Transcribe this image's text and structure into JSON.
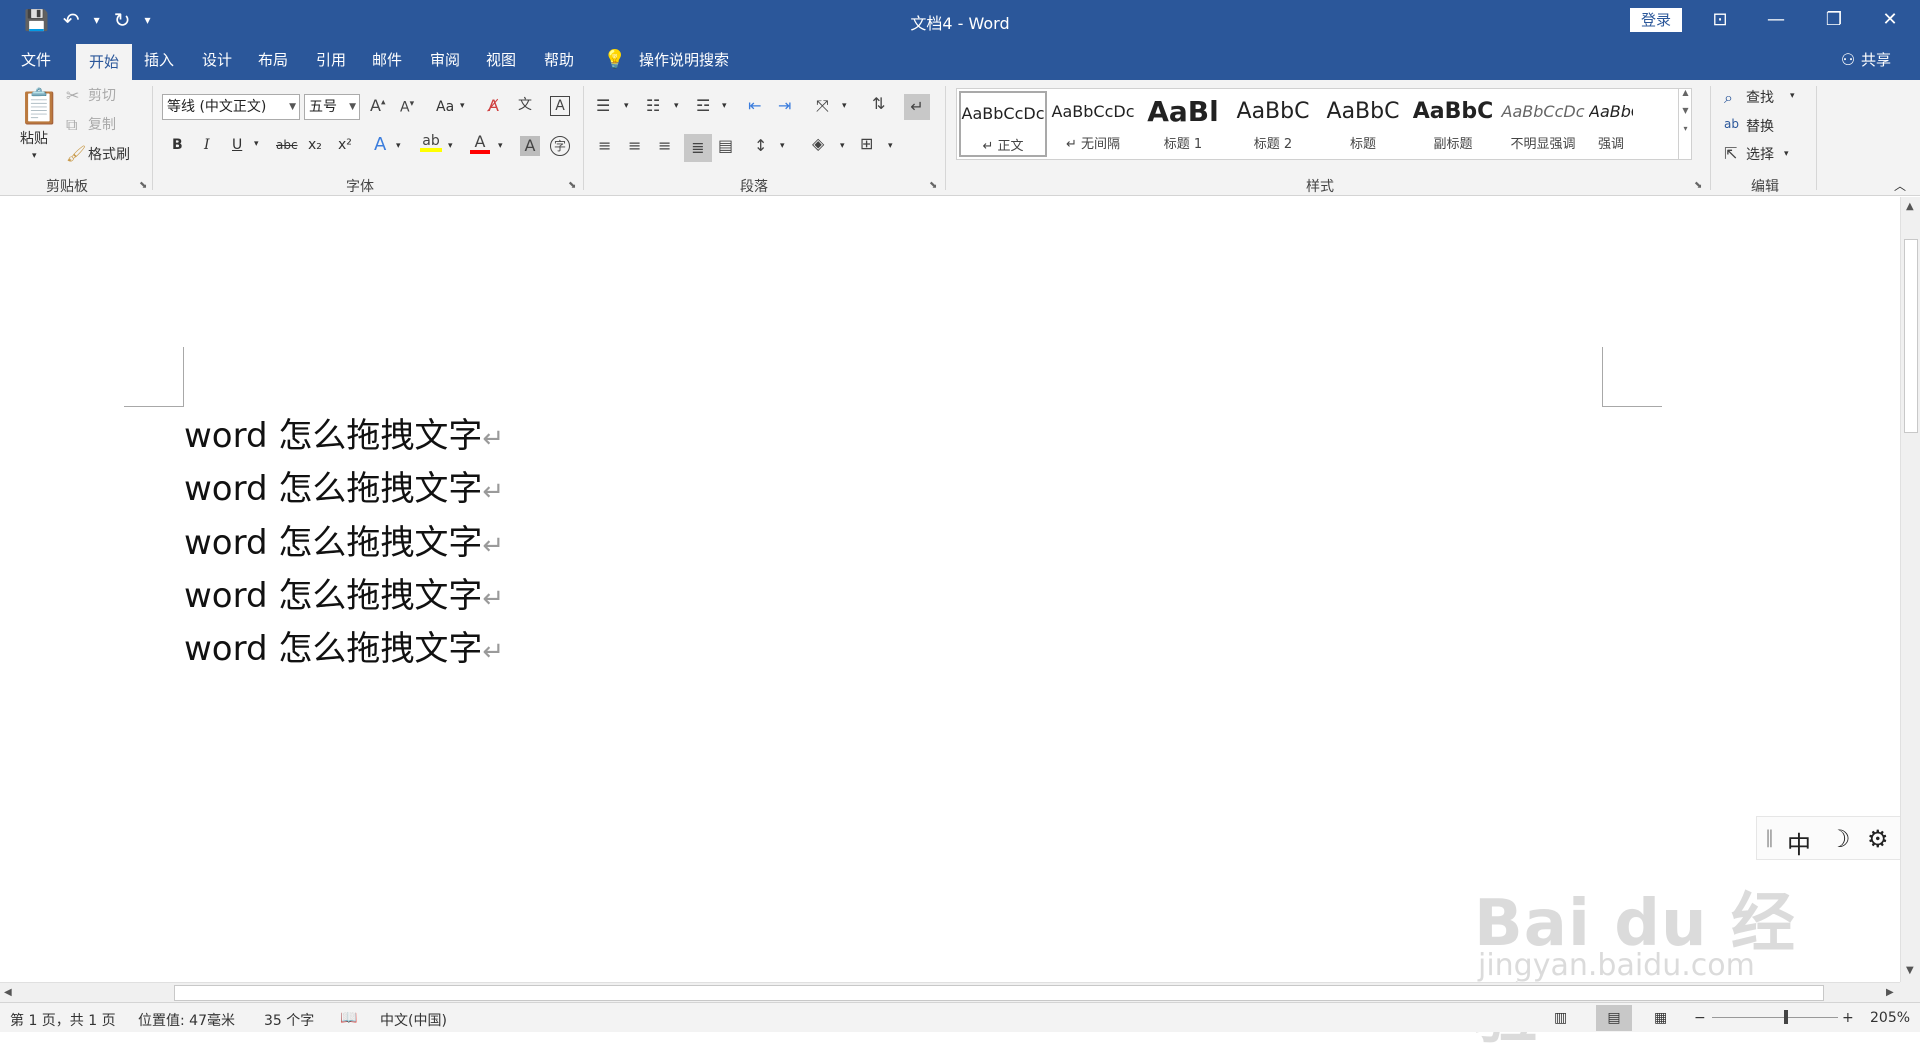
{
  "window": {
    "title": "文档4  -  Word",
    "login_label": "登录"
  },
  "quick_access": {
    "save_icon": "save-icon",
    "undo_icon": "undo-icon",
    "redo_icon": "redo-icon",
    "customize_icon": "customize-icon"
  },
  "tabs": [
    {
      "label": "文件"
    },
    {
      "label": "开始"
    },
    {
      "label": "插入"
    },
    {
      "label": "设计"
    },
    {
      "label": "布局"
    },
    {
      "label": "引用"
    },
    {
      "label": "邮件"
    },
    {
      "label": "审阅"
    },
    {
      "label": "视图"
    },
    {
      "label": "帮助"
    }
  ],
  "tell_me": "操作说明搜索",
  "share_label": "共享",
  "clipboard": {
    "paste": "粘贴",
    "cut": "剪切",
    "copy": "复制",
    "format_painter": "格式刷",
    "label": "剪贴板"
  },
  "font": {
    "name": "等线 (中文正文)",
    "size": "五号",
    "label": "字体",
    "aa": "Aa",
    "a": "A",
    "bold": "B",
    "italic": "I",
    "underline": "U",
    "strike": "abc",
    "sub": "x₂",
    "sup": "x²"
  },
  "paragraph": {
    "label": "段落"
  },
  "styles": {
    "label": "样式",
    "items": [
      {
        "preview": "AaBbCcDc",
        "name": "↵ 正文"
      },
      {
        "preview": "AaBbCcDc",
        "name": "↵ 无间隔"
      },
      {
        "preview": "AaBl",
        "name": "标题 1"
      },
      {
        "preview": "AaBbC",
        "name": "标题 2"
      },
      {
        "preview": "AaBbC",
        "name": "标题"
      },
      {
        "preview": "AaBbC",
        "name": "副标题"
      },
      {
        "preview": "AaBbCcDc",
        "name": "不明显强调"
      },
      {
        "preview": "AaBbCcDc",
        "name": "强调"
      }
    ]
  },
  "editing": {
    "find": "查找",
    "replace": "替换",
    "select": "选择",
    "label": "编辑"
  },
  "document": {
    "lines": [
      {
        "text": "word 怎么拖拽文字"
      },
      {
        "text": "word 怎么拖拽文字"
      },
      {
        "text": "word 怎么拖拽文字"
      },
      {
        "text": "word 怎么拖拽文字"
      },
      {
        "text": "word 怎么拖拽文字"
      }
    ],
    "paragraph_mark": "↵"
  },
  "ime": {
    "mode": "中"
  },
  "watermark": {
    "brand": "Bai du 经验",
    "url": "jingyan.baidu.com"
  },
  "status": {
    "page": "第 1 页，共 1 页",
    "position": "位置值: 47毫米",
    "words": "35 个字",
    "language": "中文(中国)",
    "zoom": "205%",
    "zoom_level": 0.59
  },
  "colors": {
    "accent": "#2b579a",
    "highlight": "#ffff00",
    "font_color": "#ff0000"
  }
}
